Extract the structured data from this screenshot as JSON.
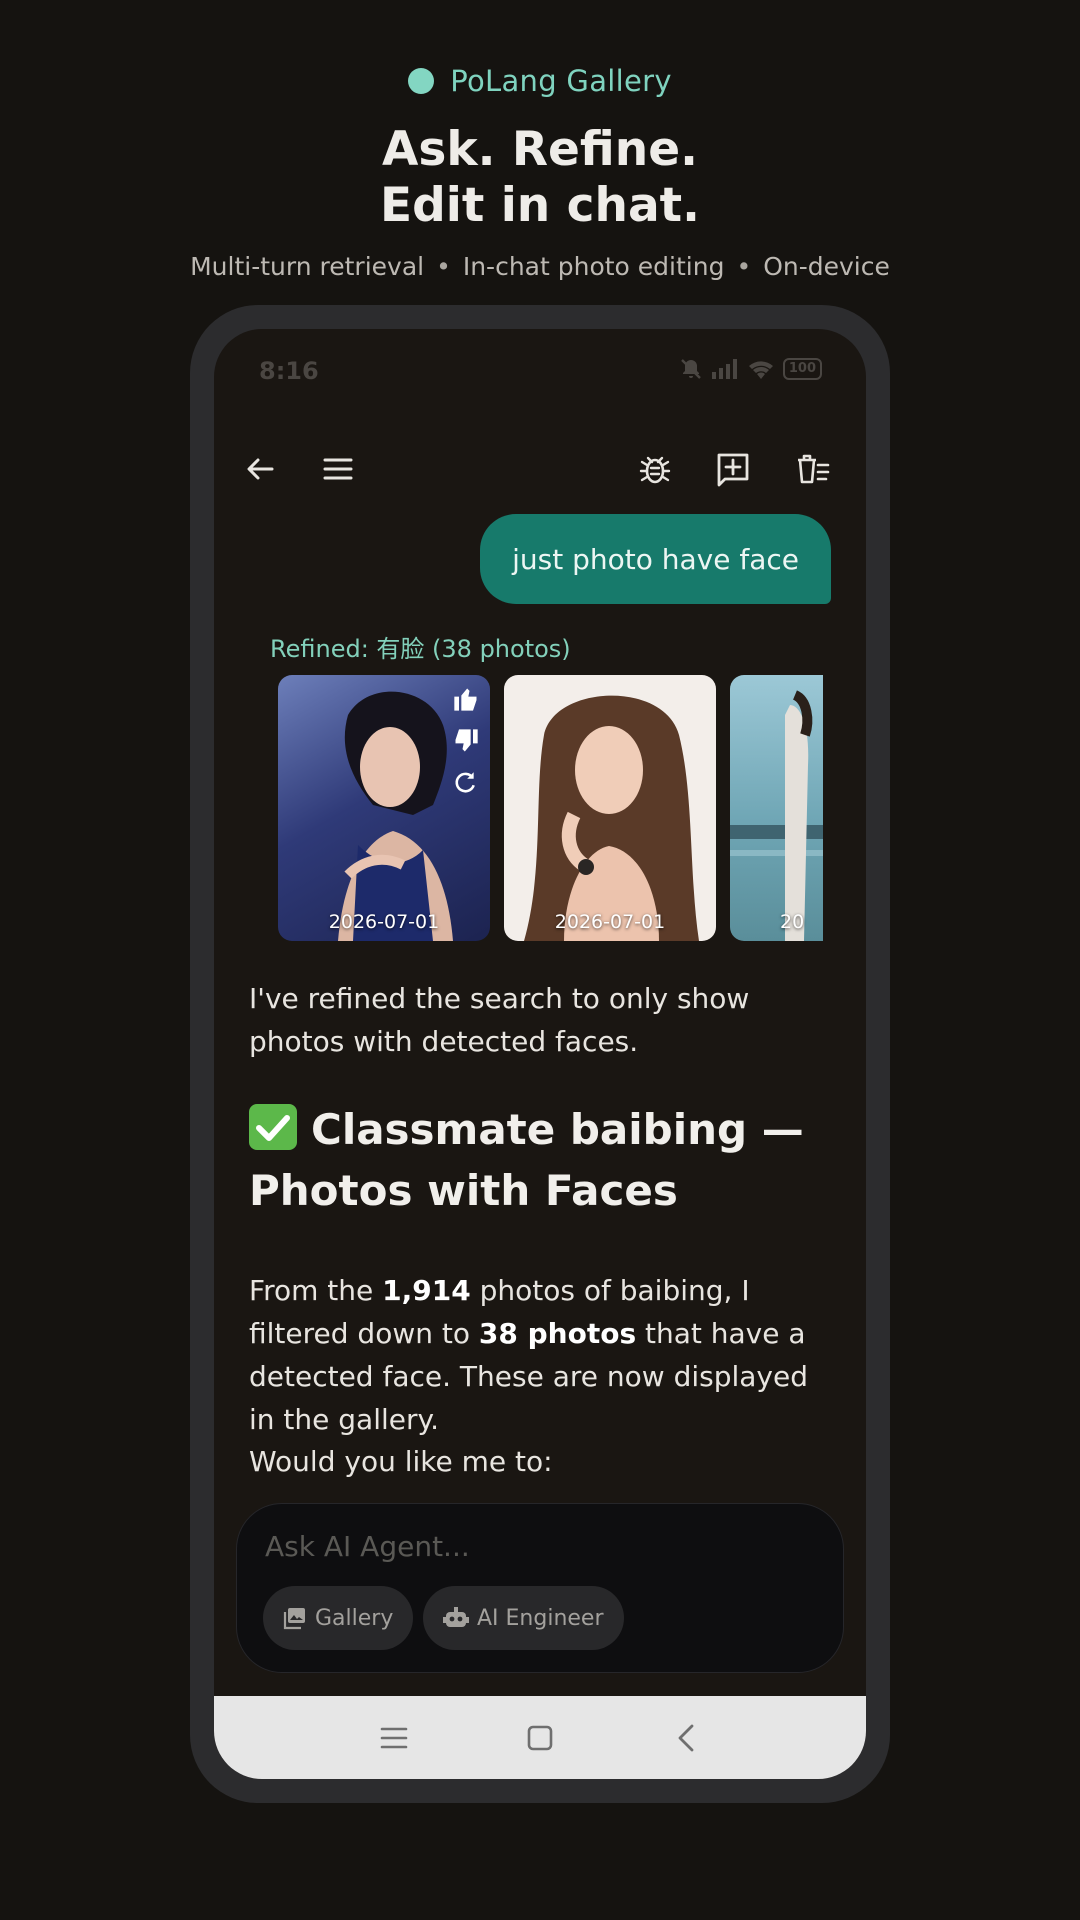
{
  "promo": {
    "brand": "PoLang Gallery",
    "headline_line1": "Ask. Refine.",
    "headline_line2": "Edit in chat.",
    "feature1": "Multi-turn retrieval",
    "feature2": "In-chat photo editing",
    "feature3": "On-device",
    "separator": "•"
  },
  "status_bar": {
    "time": "8:16",
    "battery": "100"
  },
  "app_bar": {
    "icons": [
      "back-arrow-icon",
      "menu-icon",
      "bug-icon",
      "new-chat-icon",
      "clear-chat-icon"
    ]
  },
  "chat": {
    "user_message": "just photo have face",
    "refined_label": "Refined: 有脸 (38 photos)",
    "photos": [
      {
        "date": "2026-07-01"
      },
      {
        "date": "2026-07-01"
      },
      {
        "date": "20"
      }
    ],
    "reply_para1": "I've refined the search to only show photos with detected faces.",
    "reply_heading": "Classmate baibing — Photos with Faces",
    "reply_para2_a": "From the ",
    "reply_para2_b": "1,914",
    "reply_para2_c": " photos of baibing, I filtered down to ",
    "reply_para2_d": "38 photos",
    "reply_para2_e": " that have a detected face. These are now displayed in the gallery.",
    "reply_para3": "Would you like me to:"
  },
  "composer": {
    "placeholder": "Ask AI Agent...",
    "chip_gallery": "Gallery",
    "chip_engineer": "AI Engineer"
  },
  "colors": {
    "accent": "#7fd3bf",
    "user_bubble": "#177a6b",
    "background": "#151310"
  }
}
